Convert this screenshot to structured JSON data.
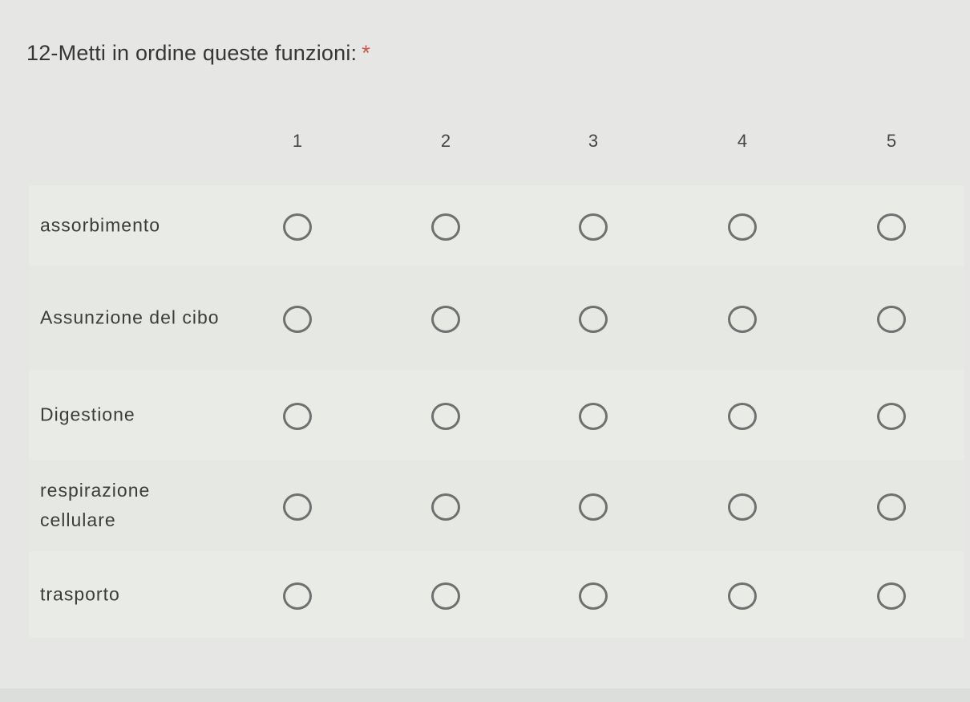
{
  "question": {
    "title": "12-Metti in ordine queste funzioni:",
    "required_marker": "*"
  },
  "columns": [
    "1",
    "2",
    "3",
    "4",
    "5"
  ],
  "rows": [
    {
      "label": "assorbimento"
    },
    {
      "label": "Assunzione del cibo"
    },
    {
      "label": "Digestione"
    },
    {
      "label": "respirazione cellulare"
    },
    {
      "label": "trasporto"
    }
  ],
  "colors": {
    "background": "#e6e7e4",
    "row_background": "#e8ebe6",
    "radio_border": "#6f706f",
    "required_star": "#c9554e"
  }
}
